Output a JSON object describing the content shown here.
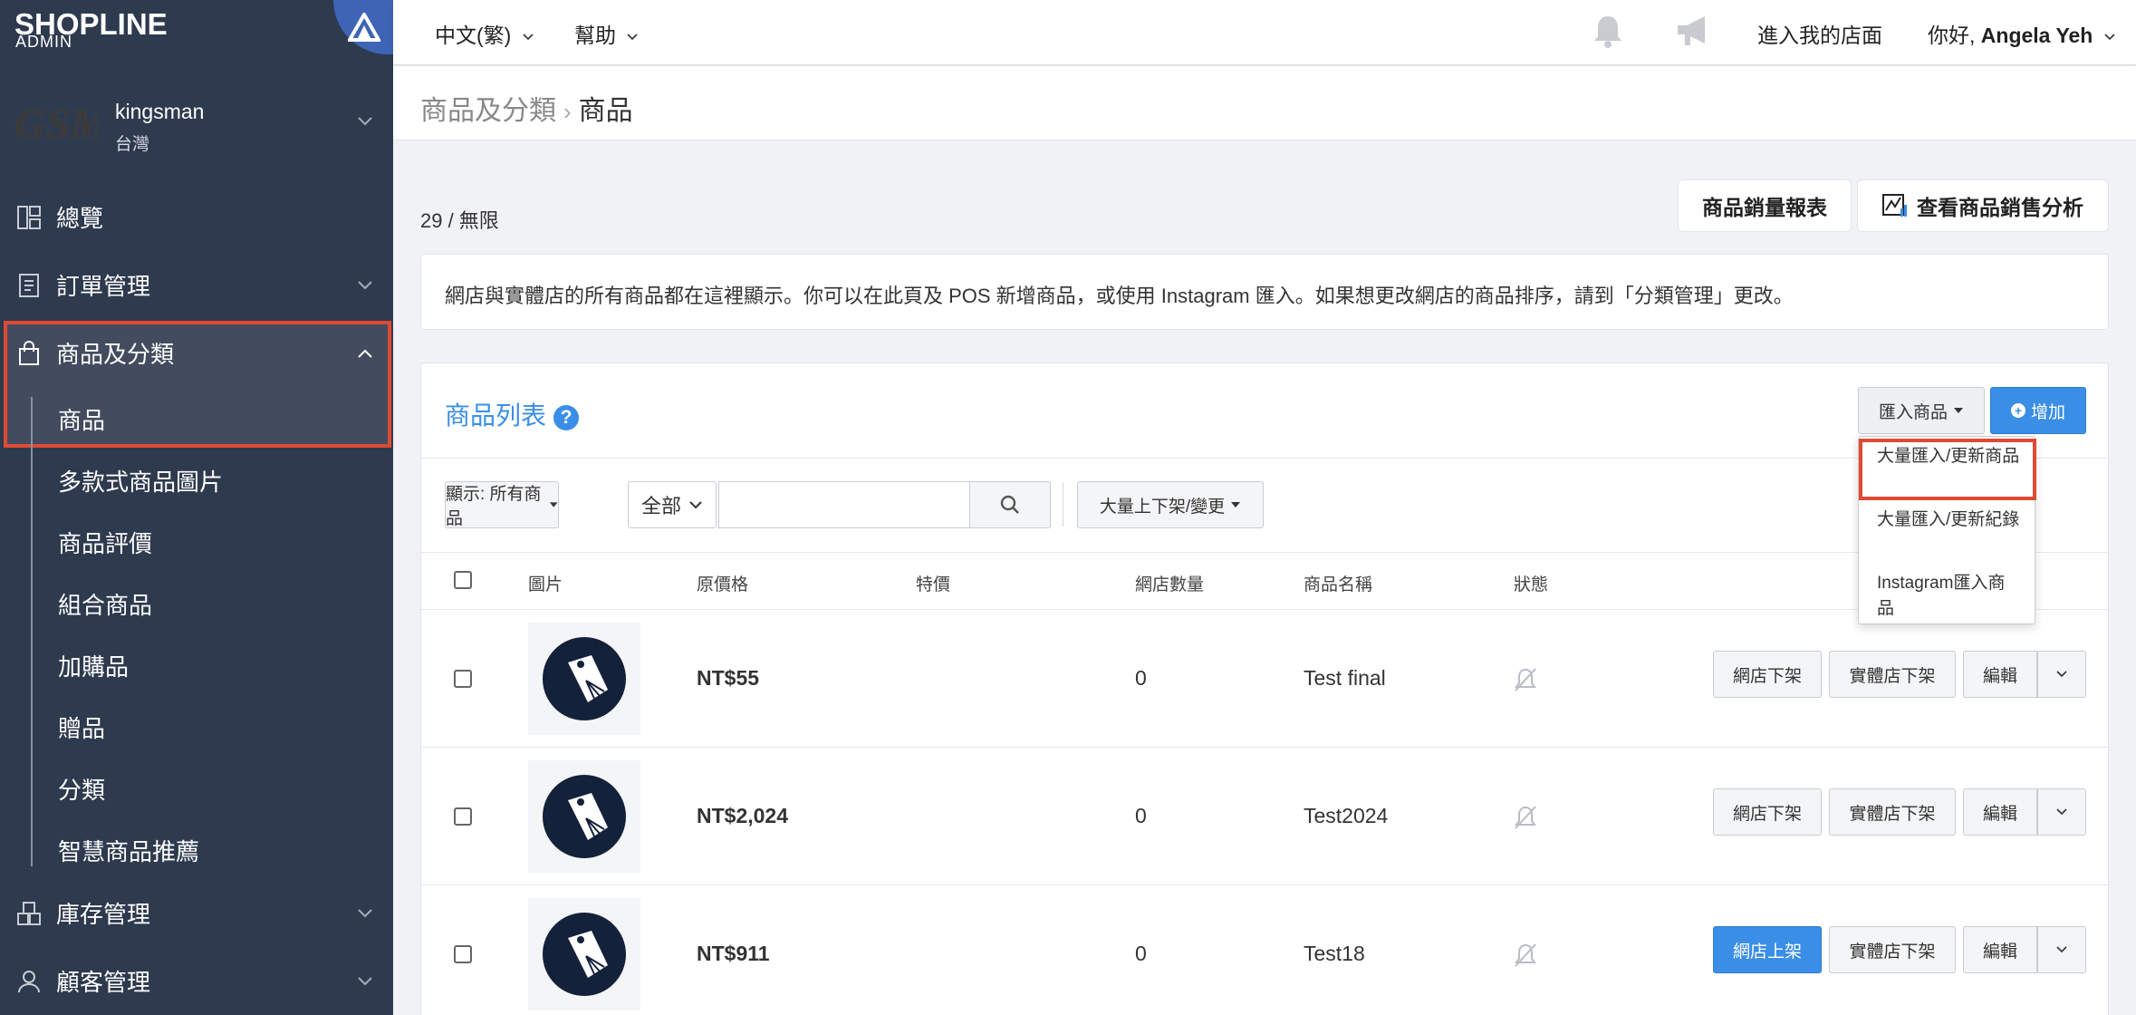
{
  "sidebar": {
    "logo_text": "SHOPLINE",
    "logo_sub": "ADMIN",
    "store_logo_text": "GSM",
    "store_name": "kingsman",
    "store_region": "台灣",
    "items": [
      {
        "label": "總覽",
        "icon": "dashboard-icon"
      },
      {
        "label": "訂單管理",
        "icon": "clipboard-icon"
      },
      {
        "label": "商品及分類",
        "icon": "shopping-bag-icon"
      },
      {
        "label": "庫存管理",
        "icon": "inventory-icon"
      },
      {
        "label": "顧客管理",
        "icon": "person-icon"
      }
    ],
    "sub_items": [
      "商品",
      "多款式商品圖片",
      "商品評價",
      "組合商品",
      "加購品",
      "贈品",
      "分類",
      "智慧商品推薦"
    ]
  },
  "topbar": {
    "language": "中文(繁)",
    "help": "幫助",
    "enter_store": "進入我的店面",
    "greeting": "你好, ",
    "user_name": "Angela Yeh"
  },
  "breadcrumb": {
    "parent": "商品及分類",
    "current": "商品"
  },
  "quota": "29 / 無限",
  "buttons": {
    "sales_report": "商品銷量報表",
    "sales_analysis": "查看商品銷售分析"
  },
  "notice": "網店與實體店的所有商品都在這裡顯示。你可以在此頁及 POS 新增商品，或使用 Instagram 匯入。如果想更改網店的商品排序，請到「分類管理」更改。",
  "panel": {
    "title": "商品列表",
    "import_label": "匯入商品",
    "add_label": "增加",
    "dropdown": [
      "大量匯入/更新商品",
      "大量匯入/更新紀錄",
      "Instagram匯入商品"
    ],
    "filter_display": "顯示: 所有商品",
    "filter_scope": "全部",
    "search_value": "",
    "bulk_label": "大量上下架/變更"
  },
  "table": {
    "headers": [
      "圖片",
      "原價格",
      "特價",
      "網店數量",
      "商品名稱",
      "狀態"
    ],
    "rows": [
      {
        "price": "NT$55",
        "sale": "",
        "qty": "0",
        "name": "Test final",
        "online_btn": "網店下架",
        "store_btn": "實體店下架",
        "edit": "編輯",
        "online_primary": false
      },
      {
        "price": "NT$2,024",
        "sale": "",
        "qty": "0",
        "name": "Test2024",
        "online_btn": "網店下架",
        "store_btn": "實體店下架",
        "edit": "編輯",
        "online_primary": false
      },
      {
        "price": "NT$911",
        "sale": "",
        "qty": "0",
        "name": "Test18",
        "online_btn": "網店上架",
        "store_btn": "實體店下架",
        "edit": "編輯",
        "online_primary": true
      }
    ]
  },
  "colors": {
    "sidebar_bg": "#2e3a4e",
    "accent": "#3a8ee6",
    "highlight": "#e04a35"
  }
}
